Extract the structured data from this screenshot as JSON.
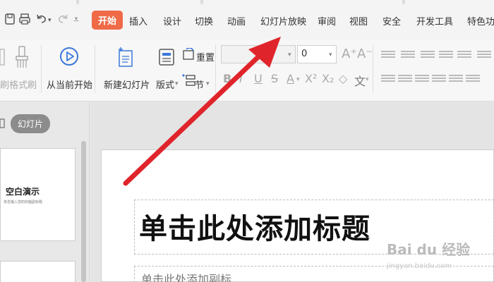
{
  "tabs": {
    "active": "开始",
    "items": [
      "插入",
      "设计",
      "切换",
      "动画",
      "幻灯片放映",
      "审阅",
      "视图",
      "安全",
      "开发工具",
      "特色功能"
    ]
  },
  "ribbon": {
    "partial_left": "刷",
    "format_painter": "格式刷",
    "play_from_current": "从当前开始",
    "new_slide": "新建幻灯片",
    "layout": "版式",
    "reset": "重置",
    "section": "节",
    "font_size": "0",
    "phonetic": "文"
  },
  "panel": {
    "tab_label": "幻灯片",
    "thumbnail_title": "空白演示",
    "thumbnail_subtitle": "单击输入您的封面副标题"
  },
  "slide": {
    "title_placeholder": "单击此处添加标题",
    "subtitle_placeholder": "单击此处添加副标"
  },
  "watermark": {
    "brand": "Bai du 经验",
    "url": "jingyan.baidu.com"
  },
  "colors": {
    "active_tab": "#ef6a47",
    "annotation_arrow": "#e0242b",
    "play_icon": "#3a78d8"
  },
  "icons": [
    "save-icon",
    "print-icon",
    "undo-icon",
    "redo-icon",
    "dropdown-icon",
    "play-icon",
    "new-slide-icon",
    "layout-icon",
    "reset-icon",
    "section-icon"
  ]
}
